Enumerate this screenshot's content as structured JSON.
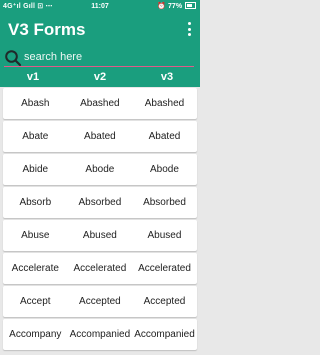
{
  "status_bar": {
    "network": "4G⁺ıl Gıll",
    "icons": "⊡ ⋯",
    "time": "11:07",
    "battery": "77%"
  },
  "app": {
    "title": "V3 Forms"
  },
  "search": {
    "placeholder": "search here",
    "value": ""
  },
  "columns": [
    "v1",
    "v2",
    "v3"
  ],
  "rows": [
    [
      "Abash",
      "Abashed",
      "Abashed"
    ],
    [
      "Abate",
      "Abated",
      "Abated"
    ],
    [
      "Abide",
      "Abode",
      "Abode"
    ],
    [
      "Absorb",
      "Absorbed",
      "Absorbed"
    ],
    [
      "Abuse",
      "Abused",
      "Abused"
    ],
    [
      "Accelerate",
      "Accelerated",
      "Accelerated"
    ],
    [
      "Accept",
      "Accepted",
      "Accepted"
    ],
    [
      "Accompany",
      "Accompanied",
      "Accompanied"
    ]
  ],
  "colors": {
    "header_bg": "#1a9e7e",
    "search_underline": "#e05a8a",
    "list_bg": "#e8e8e8"
  }
}
